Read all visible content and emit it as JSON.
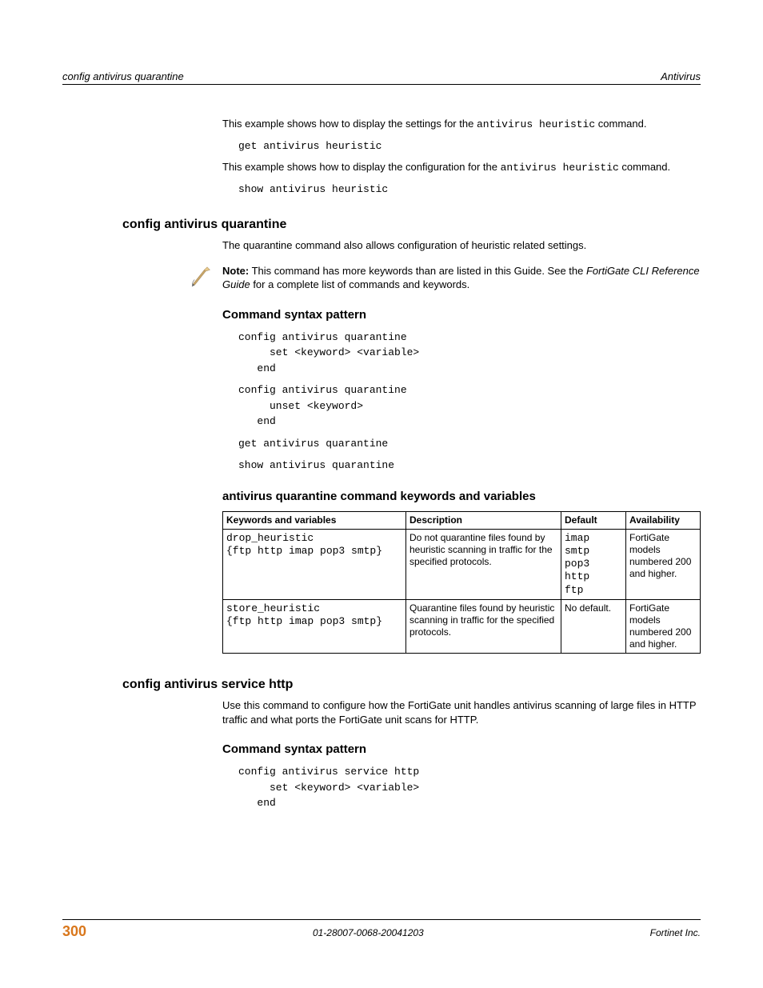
{
  "header": {
    "left": "config antivirus quarantine",
    "right": "Antivirus"
  },
  "intro": {
    "p1_a": "This example shows how to display the settings for the ",
    "p1_code": "antivirus heuristic",
    "p1_b": " command.",
    "code1": "get antivirus heuristic",
    "p2_a": "This example shows how to display the configuration for the ",
    "p2_code": "antivirus heuristic",
    "p2_b": " command.",
    "code2": "show antivirus heuristic"
  },
  "section_quarantine": {
    "title": "config antivirus quarantine",
    "p1": "The quarantine command also allows configuration of heuristic related settings.",
    "note_label": "Note:",
    "note_a": " This command has more keywords than are listed in this Guide. See the ",
    "note_em": "FortiGate CLI Reference Guide",
    "note_b": " for a complete list of commands and keywords.",
    "syntax_title": "Command syntax pattern",
    "syntax_block1": "config antivirus quarantine\n     set <keyword> <variable>\n   end",
    "syntax_block2": "config antivirus quarantine\n     unset <keyword>\n   end",
    "syntax_line3": "get antivirus quarantine",
    "syntax_line4": "show antivirus quarantine",
    "table_title": "antivirus quarantine command keywords and variables",
    "table": {
      "headers": {
        "kw": "Keywords and variables",
        "desc": "Description",
        "def": "Default",
        "avail": "Availability"
      },
      "rows": [
        {
          "kw_l1": "drop_heuristic",
          "kw_l2": "{ftp http imap pop3 smtp}",
          "desc": "Do not quarantine files found by heuristic scanning in traffic for the specified protocols.",
          "def": "imap\nsmtp\npop3\nhttp\nftp",
          "avail": "FortiGate models numbered 200 and higher."
        },
        {
          "kw_l1": "store_heuristic",
          "kw_l2": "{ftp http imap pop3 smtp}",
          "desc": "Quarantine files found by heuristic scanning in traffic for the specified protocols.",
          "def": "No default.",
          "avail": "FortiGate models numbered 200 and higher."
        }
      ]
    }
  },
  "section_http": {
    "title": "config antivirus service http",
    "p1": "Use this command to configure how the FortiGate unit handles antivirus scanning of large files in HTTP traffic and what ports the FortiGate unit scans for HTTP.",
    "syntax_title": "Command syntax pattern",
    "syntax_block": "config antivirus service http\n     set <keyword> <variable>\n   end"
  },
  "footer": {
    "page": "300",
    "doc_id": "01-28007-0068-20041203",
    "company": "Fortinet Inc."
  }
}
